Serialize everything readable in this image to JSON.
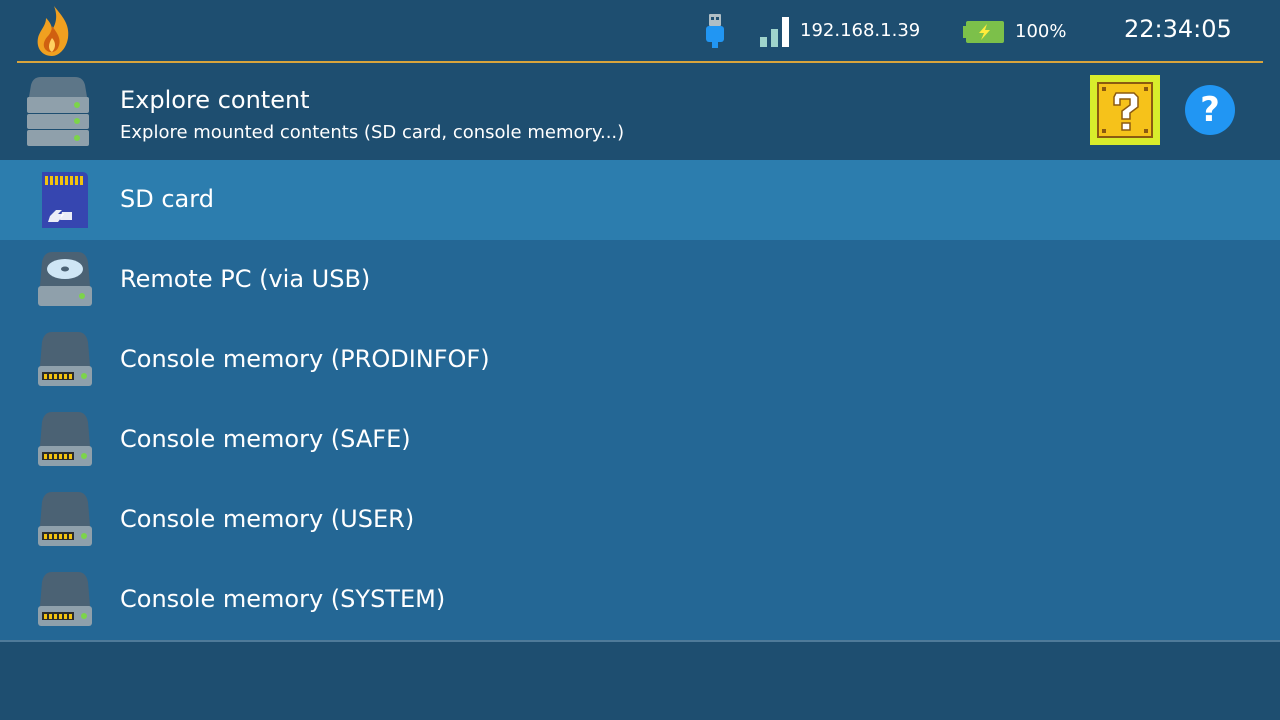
{
  "statusbar": {
    "ip": "192.168.1.39",
    "battery": "100%",
    "time": "22:34:05",
    "icons": [
      "flame-logo-icon",
      "usb-icon",
      "wifi-signal-icon",
      "battery-charging-icon"
    ]
  },
  "header": {
    "title": "Explore content",
    "subtitle": "Explore mounted contents (SD card, console memory...)",
    "icons": [
      "storage-stack-icon",
      "question-block-icon",
      "help-icon"
    ],
    "help_glyph": "?"
  },
  "items": [
    {
      "label": "SD card",
      "icon": "sd-card-icon",
      "selected": true
    },
    {
      "label": "Remote PC (via USB)",
      "icon": "optical-drive-icon"
    },
    {
      "label": "Console memory (PRODINFOF)",
      "icon": "memory-drive-icon"
    },
    {
      "label": "Console memory (SAFE)",
      "icon": "memory-drive-icon"
    },
    {
      "label": "Console memory (USER)",
      "icon": "memory-drive-icon"
    },
    {
      "label": "Console memory (SYSTEM)",
      "icon": "memory-drive-icon"
    }
  ],
  "colors": {
    "background": "#1e4e70",
    "list_background": "#246795",
    "selected_row": "#2c7dae",
    "accent_rule": "#d9a43c",
    "help_button": "#2196f3",
    "question_block_highlight": "#d8ec2c"
  }
}
